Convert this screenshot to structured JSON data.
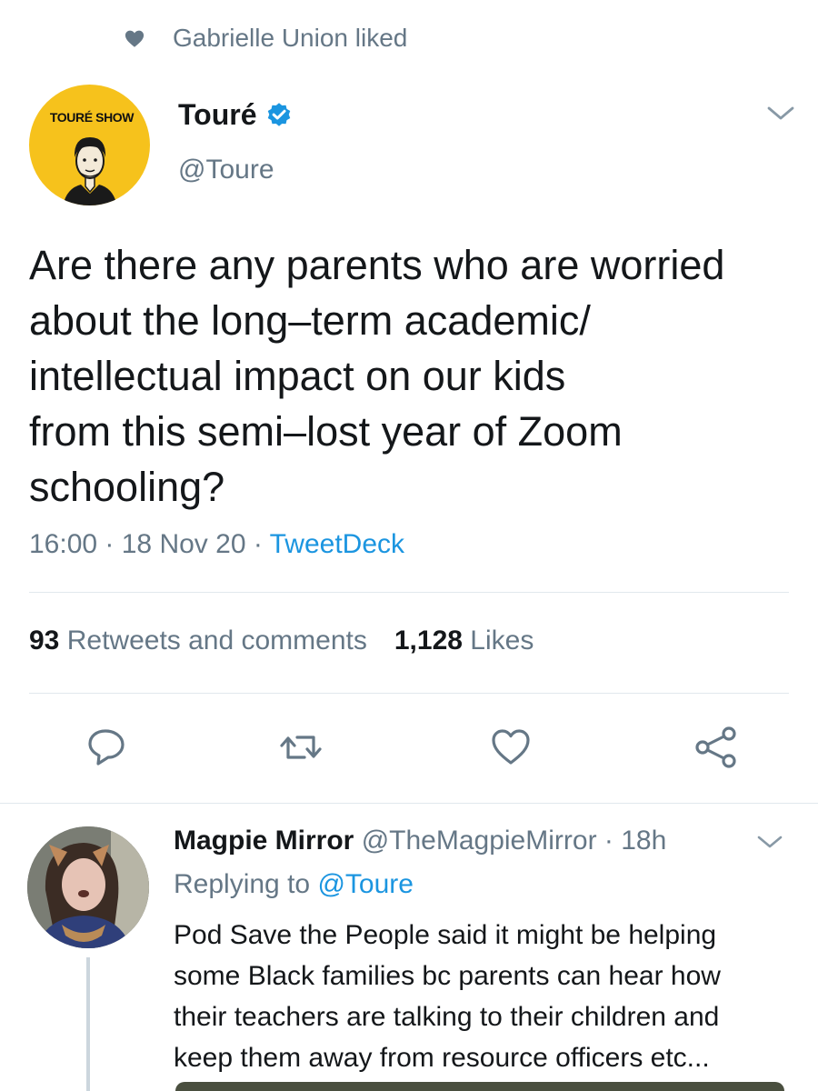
{
  "social_context": {
    "icon": "heart-icon",
    "text": "Gabrielle Union liked"
  },
  "tweet": {
    "avatar": {
      "brand_text": "TOURÉ SHOW",
      "background": "#f6c21c"
    },
    "display_name": "Touré",
    "verified_icon": "verified-badge-icon",
    "handle": "@Toure",
    "text_lines": [
      "Are there any parents who are worried",
      "about the long–term academic/",
      "intellectual impact on our kids",
      "from this semi–lost year of Zoom",
      "schooling?"
    ],
    "time": "16:00",
    "date": "18 Nov 20",
    "source": "TweetDeck",
    "separator": " · ",
    "stats": {
      "retweets_count": "93",
      "retweets_label": "Retweets and comments",
      "likes_count": "1,128",
      "likes_label": "Likes"
    },
    "actions": [
      "reply-icon",
      "retweet-icon",
      "like-icon",
      "share-icon"
    ]
  },
  "reply": {
    "display_name": "Magpie Mirror",
    "handle": "@TheMagpieMirror",
    "separator": " · ",
    "age": "18h",
    "replying_prefix": "Replying to",
    "replying_to": "@Toure",
    "text_lines": [
      "Pod Save the People said it might be helping",
      "some Black families bc parents can hear how",
      "their teachers are talking to their children and",
      "keep them away from resource officers etc..."
    ]
  },
  "colors": {
    "primary_text": "#14171a",
    "secondary_text": "#657786",
    "accent": "#1b95e0",
    "divider": "#e1e8ed"
  }
}
